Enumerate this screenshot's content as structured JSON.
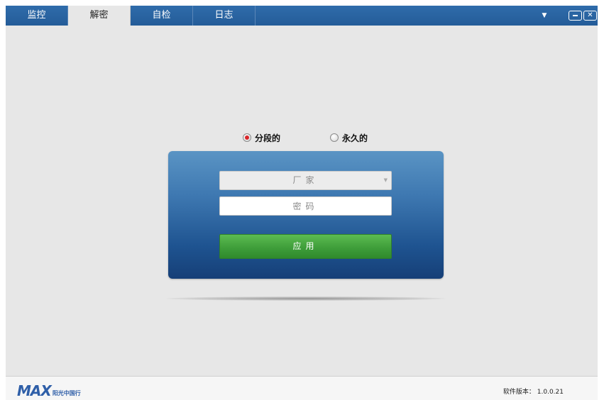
{
  "tabs": [
    {
      "label": "监控",
      "active": false
    },
    {
      "label": "解密",
      "active": true
    },
    {
      "label": "自检",
      "active": false
    },
    {
      "label": "日志",
      "active": false
    }
  ],
  "window_controls": {
    "menu_icon": "dropdown-triangle-icon",
    "minimize_icon": "minimize-icon",
    "close_icon": "close-icon",
    "close_glyph": "✕"
  },
  "mode": {
    "options": [
      {
        "label": "分段的",
        "selected": true
      },
      {
        "label": "永久的",
        "selected": false
      }
    ]
  },
  "form": {
    "vendor_placeholder": "厂家",
    "password_placeholder": "密码",
    "apply_label": "应用"
  },
  "footer": {
    "logo_text": "MAX",
    "logo_sub": "阳光中国行",
    "version_label": "软件版本：",
    "version_value": "1.0.0.21"
  },
  "colors": {
    "topbar": "#2a66a4",
    "panel_top": "#5a94c4",
    "panel_bottom": "#163f77",
    "apply_green": "#3f9e3a",
    "radio_selected": "#d8262a",
    "background": "#e7e7e7"
  }
}
